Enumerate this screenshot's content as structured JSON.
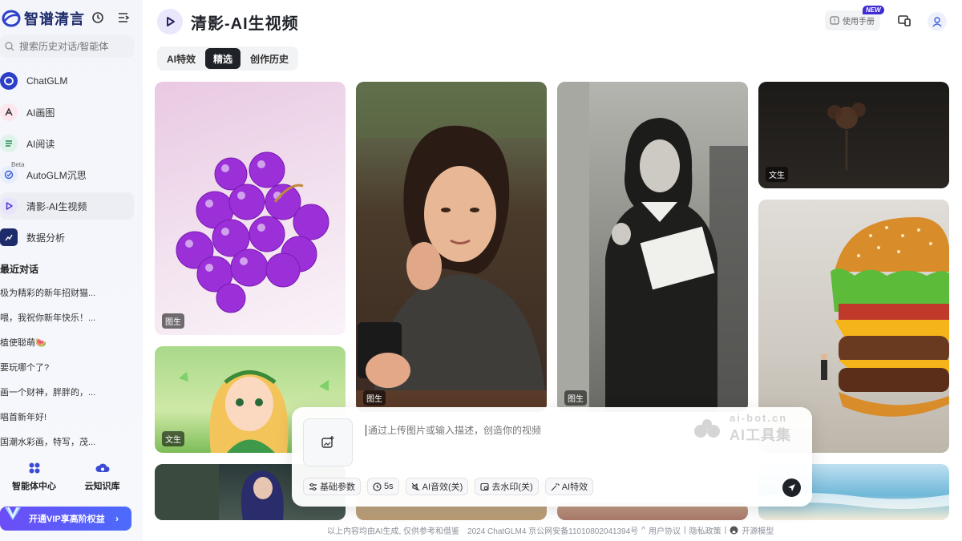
{
  "app": {
    "logo_text": "智谱清言"
  },
  "sidebar": {
    "search_placeholder": "搜索历史对话/智能体",
    "nav": [
      {
        "label": "ChatGLM",
        "icon": "chatglm-icon"
      },
      {
        "label": "AI画图",
        "icon": "ai-paint-icon"
      },
      {
        "label": "AI阅读",
        "icon": "ai-read-icon"
      },
      {
        "label": "AutoGLM沉思",
        "icon": "autoglm-icon",
        "badge": "Beta"
      },
      {
        "label": "清影-AI生视频",
        "icon": "video-play-icon"
      },
      {
        "label": "数据分析",
        "icon": "data-analysis-icon"
      }
    ],
    "recent_title": "最近对话",
    "recent": [
      "极为精彩的新年招财猫...",
      "喂，我祝你新年快乐！...",
      "植使聪萌🍉",
      "要玩哪个了?",
      "画一个财神，胖胖的，...",
      "唱首新年好!",
      "国潮水彩画，特写，茂..."
    ],
    "tools": [
      {
        "label": "智能体中心",
        "icon": "agent-center-icon"
      },
      {
        "label": "云知识库",
        "icon": "cloud-kb-icon"
      }
    ],
    "vip_label": "开通VIP享高阶权益",
    "colors": {
      "accent": "#5b4cf0",
      "vip_start": "#6c4df6",
      "vip_end": "#4b6bfb"
    }
  },
  "header": {
    "title": "清影-AI生视频",
    "help_label": "使用手册",
    "new_badge": "NEW"
  },
  "tabs": [
    {
      "label": "AI特效"
    },
    {
      "label": "精选"
    },
    {
      "label": "创作历史"
    }
  ],
  "gallery": {
    "cards": [
      {
        "tag": "图生",
        "subject": "purple glass grapes"
      },
      {
        "tag": "文生",
        "subject": "cartoon girl with butterflies"
      },
      {
        "tag": "",
        "subject": "fantasy characters in library"
      },
      {
        "tag": "图生",
        "subject": "young woman holding phone"
      },
      {
        "tag": "",
        "subject": "partial bottom"
      },
      {
        "tag": "图生",
        "subject": "woman in black and white street"
      },
      {
        "tag": "",
        "subject": "partial bottom"
      },
      {
        "tag": "文生",
        "subject": "dark flower still life"
      },
      {
        "tag": "",
        "subject": "giant burger with tiny man"
      },
      {
        "tag": "",
        "subject": "beach waves"
      }
    ]
  },
  "prompt": {
    "placeholder": "通过上传图片或输入描述，创造你的视频",
    "options": [
      {
        "label": "基础参数",
        "icon": "sliders-icon"
      },
      {
        "label": "5s",
        "icon": "clock-icon"
      },
      {
        "label": "AI音效(关)",
        "icon": "sound-off-icon"
      },
      {
        "label": "去水印(关)",
        "icon": "watermark-icon"
      },
      {
        "label": "AI特效",
        "icon": "magic-icon"
      }
    ],
    "watermark_top": "ai-bot.cn",
    "watermark_bottom": "AI工具集"
  },
  "footer": {
    "disclaimer": "以上内容均由AI生成, 仅供参考和借鉴",
    "copyright": "2024 ChatGLM4 京公网安备11010802041394号",
    "links": [
      "用户协议",
      "隐私政策",
      "开源模型"
    ]
  }
}
